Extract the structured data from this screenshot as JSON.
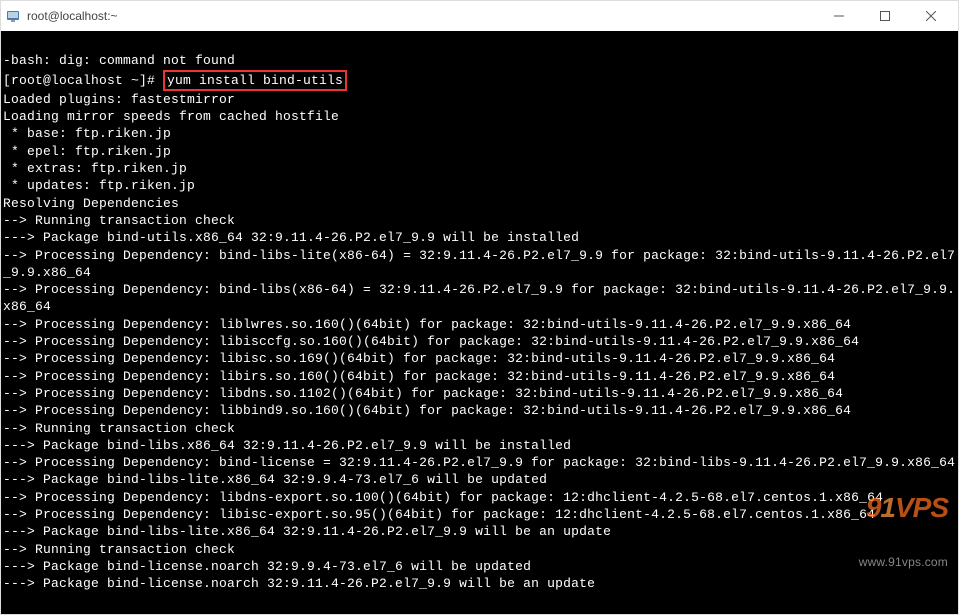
{
  "titlebar": {
    "title": "root@localhost:~"
  },
  "terminal": {
    "error_line": "-bash: dig: command not found",
    "prompt": "[root@localhost ~]# ",
    "command": "yum install bind-utils",
    "output": "Loaded plugins: fastestmirror\nLoading mirror speeds from cached hostfile\n * base: ftp.riken.jp\n * epel: ftp.riken.jp\n * extras: ftp.riken.jp\n * updates: ftp.riken.jp\nResolving Dependencies\n--> Running transaction check\n---> Package bind-utils.x86_64 32:9.11.4-26.P2.el7_9.9 will be installed\n--> Processing Dependency: bind-libs-lite(x86-64) = 32:9.11.4-26.P2.el7_9.9 for package: 32:bind-utils-9.11.4-26.P2.el7_9.9.x86_64\n--> Processing Dependency: bind-libs(x86-64) = 32:9.11.4-26.P2.el7_9.9 for package: 32:bind-utils-9.11.4-26.P2.el7_9.9.x86_64\n--> Processing Dependency: liblwres.so.160()(64bit) for package: 32:bind-utils-9.11.4-26.P2.el7_9.9.x86_64\n--> Processing Dependency: libisccfg.so.160()(64bit) for package: 32:bind-utils-9.11.4-26.P2.el7_9.9.x86_64\n--> Processing Dependency: libisc.so.169()(64bit) for package: 32:bind-utils-9.11.4-26.P2.el7_9.9.x86_64\n--> Processing Dependency: libirs.so.160()(64bit) for package: 32:bind-utils-9.11.4-26.P2.el7_9.9.x86_64\n--> Processing Dependency: libdns.so.1102()(64bit) for package: 32:bind-utils-9.11.4-26.P2.el7_9.9.x86_64\n--> Processing Dependency: libbind9.so.160()(64bit) for package: 32:bind-utils-9.11.4-26.P2.el7_9.9.x86_64\n--> Running transaction check\n---> Package bind-libs.x86_64 32:9.11.4-26.P2.el7_9.9 will be installed\n--> Processing Dependency: bind-license = 32:9.11.4-26.P2.el7_9.9 for package: 32:bind-libs-9.11.4-26.P2.el7_9.9.x86_64\n---> Package bind-libs-lite.x86_64 32:9.9.4-73.el7_6 will be updated\n--> Processing Dependency: libdns-export.so.100()(64bit) for package: 12:dhclient-4.2.5-68.el7.centos.1.x86_64\n--> Processing Dependency: libisc-export.so.95()(64bit) for package: 12:dhclient-4.2.5-68.el7.centos.1.x86_64\n---> Package bind-libs-lite.x86_64 32:9.11.4-26.P2.el7_9.9 will be an update\n--> Running transaction check\n---> Package bind-license.noarch 32:9.9.4-73.el7_6 will be updated\n---> Package bind-license.noarch 32:9.11.4-26.P2.el7_9.9 will be an update"
  },
  "watermark": {
    "logo_prefix": "9",
    "logo_one": "1",
    "logo_suffix": "VPS",
    "url": "www.91vps.com"
  }
}
